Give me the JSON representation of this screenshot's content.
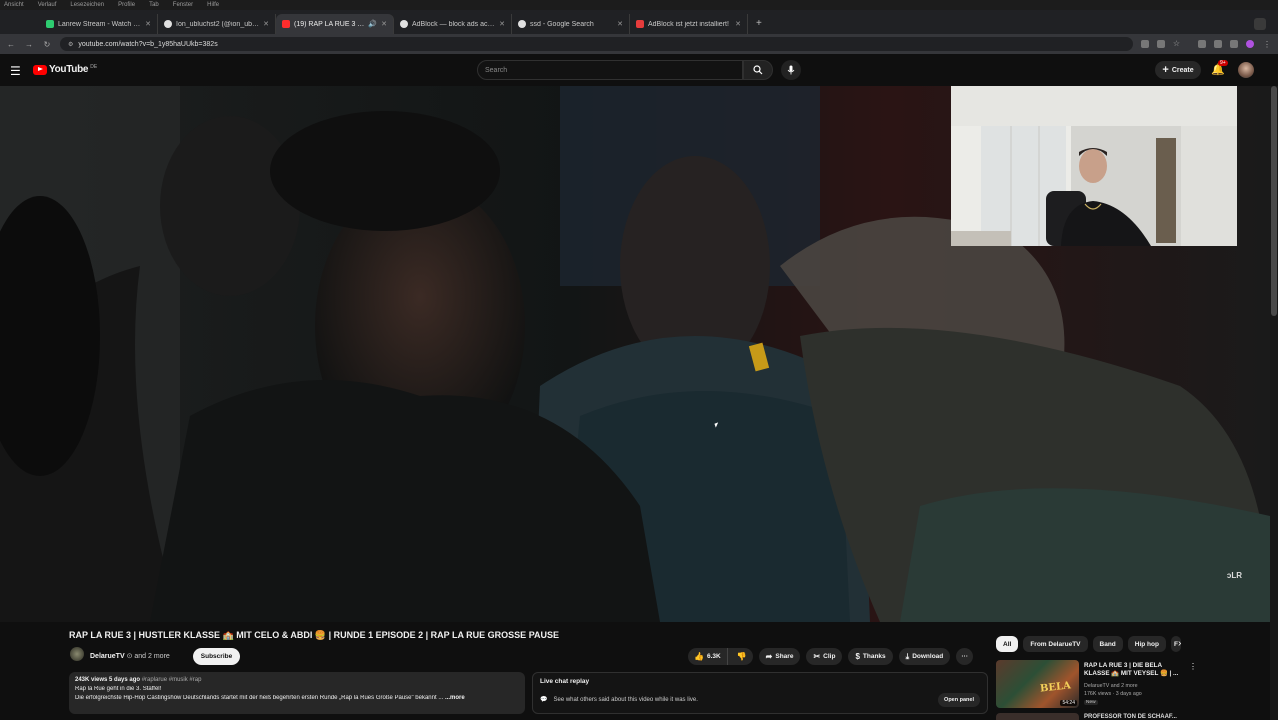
{
  "menubar": [
    "Ansicht",
    "Verlauf",
    "Lesezeichen",
    "Profile",
    "Tab",
    "Fenster",
    "Hilfe"
  ],
  "tabs": [
    {
      "title": "Lanrew Stream - Watch Live",
      "color": "#2ecc71"
    },
    {
      "title": "Ion_ubluchst2 (@ion_ubluc",
      "color": "#e0e0e0"
    },
    {
      "title": "(19) RAP LA RUE 3 | HU",
      "color": "#ff2d2d",
      "active": true
    },
    {
      "title": "AdBlock — block ads across",
      "color": "#e0e0e0"
    },
    {
      "title": "ssd - Google Search",
      "color": "#e0e0e0"
    },
    {
      "title": "AdBlock ist jetzt installiert!",
      "color": "#e63c3c"
    }
  ],
  "address": {
    "url": "youtube.com/watch?v=b_1y85haUUkb=382s"
  },
  "header": {
    "logo": "YouTube",
    "logo_region": "DE",
    "search_placeholder": "Search",
    "create_label": "Create",
    "notif_count": "9+"
  },
  "video": {
    "watermark": "ɔLR"
  },
  "details": {
    "title": "RAP LA RUE 3 | HUSTLER KLASSE 🏫 MIT CELO & ABDI 🍔 | RUNDE 1 EPISODE 2 | RAP LA RUE GROSSE PAUSE",
    "channel": "DelarueTV",
    "and_more": "and 2 more",
    "subscribe": "Subscribe",
    "likes": "6.3K",
    "share": "Share",
    "clip": "Clip",
    "thanks": "Thanks",
    "download": "Download",
    "more": "···"
  },
  "description": {
    "meta": "243K views  5 days ago",
    "tags": "#raplarue #musik #rap",
    "line1": "Rap la Rue geht in die 3. Staffel!",
    "line2": "Die erfolgreichste Hip-Hop Castingshow Deutschlands startet mit der heiß begehrten ersten Runde „Rap la Rues Große Pause\" bekannt ...",
    "more_label": "...more"
  },
  "live_chat": {
    "title": "Live chat replay",
    "message": "See what others said about this video while it was live.",
    "open_panel": "Open panel"
  },
  "chips": [
    "All",
    "From DelarueTV",
    "Band",
    "Hip hop",
    "F"
  ],
  "recommendation": {
    "title": "RAP LA RUE 3 | DIE BELA KLASSE 🏫 MIT VEYSEL 🍔 | ...",
    "channel": "DelarueTV and 2 more",
    "views": "176K views · 3 days ago",
    "badge": "New",
    "thumb_text": "BELA",
    "duration": "54:24"
  },
  "recommendation2": {
    "title": "PROFESSOR TON DE SCHAAF..."
  }
}
